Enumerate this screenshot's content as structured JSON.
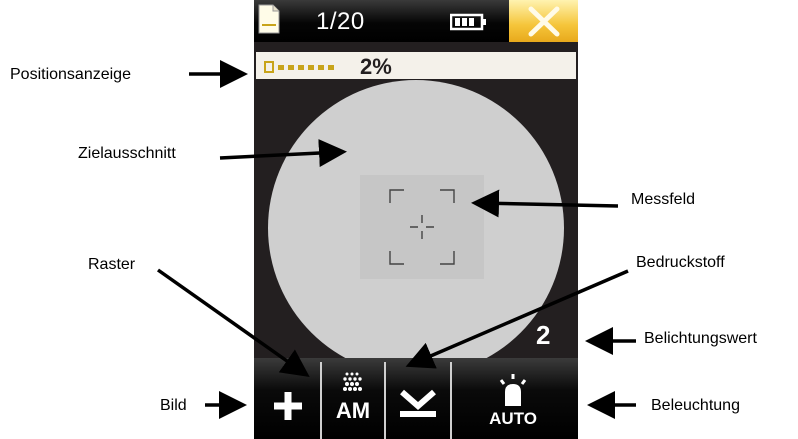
{
  "device": {
    "page_counter": "1/20",
    "position_percent": "2%",
    "exposure_value": "2",
    "raster_mode": "AM",
    "illumination_mode": "AUTO",
    "position_progress": 0.02,
    "icons": [
      "document-icon",
      "battery-icon",
      "close-icon",
      "plus-icon",
      "raster-icon",
      "substrate-icon",
      "lamp-icon"
    ],
    "colors": {
      "accent": "#f5c53a",
      "screen": "#231f20",
      "target": "#cfcfcf",
      "indicator": "#c8a41a"
    }
  },
  "annotations": {
    "positionsanzeige": "Positionsanzeige",
    "zielausschnitt": "Zielausschnitt",
    "messfeld": "Messfeld",
    "raster": "Raster",
    "bedruckstoff": "Bedruckstoff",
    "belichtungswert": "Belichtungswert",
    "bild": "Bild",
    "beleuchtung": "Beleuchtung"
  }
}
